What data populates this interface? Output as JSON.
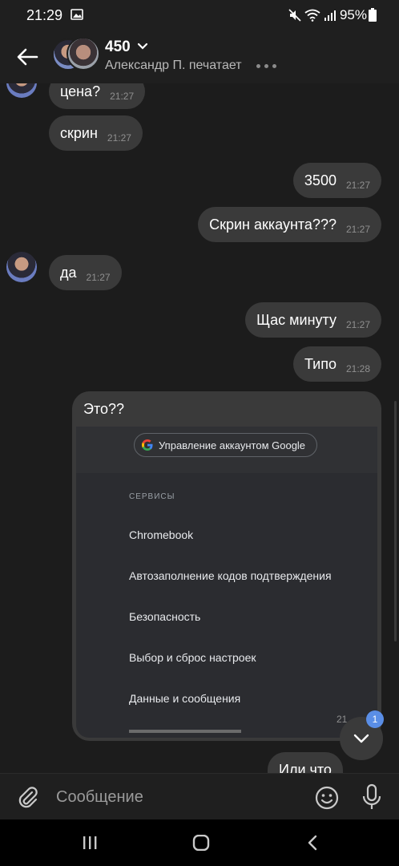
{
  "status_bar": {
    "time": "21:29",
    "battery": "95%"
  },
  "header": {
    "title": "450",
    "subtitle": "Александр П. печатает"
  },
  "messages": [
    {
      "side": "in",
      "text": "цена?",
      "time": "21:27"
    },
    {
      "side": "in",
      "text": "скрин",
      "time": "21:27"
    },
    {
      "side": "out",
      "text": "3500",
      "time": "21:27"
    },
    {
      "side": "out",
      "text": "Скрин аккаунта???",
      "time": "21:27"
    },
    {
      "side": "in",
      "text": "да",
      "time": "21:27"
    },
    {
      "side": "out",
      "text": "Щас минуту",
      "time": "21:27"
    },
    {
      "side": "out",
      "text": "Типо",
      "time": "21:28"
    },
    {
      "side": "out",
      "text": "Это??",
      "time": ""
    },
    {
      "side": "out",
      "text": "Или что",
      "time": ""
    }
  ],
  "shared_screenshot": {
    "account_button": "Управление аккаунтом Google",
    "section": "СЕРВИСЫ",
    "items": [
      "Chromebook",
      "Автозаполнение кодов подтверждения",
      "Безопасность",
      "Выбор и сброс настроек",
      "Данные и сообщения"
    ]
  },
  "jump": {
    "unread": "1",
    "peek_time": "21"
  },
  "composer": {
    "placeholder": "Сообщение"
  },
  "icons": [
    "back-arrow-icon",
    "chevron-down-icon",
    "attach-icon",
    "emoji-icon",
    "mic-icon",
    "google-g-icon",
    "chevron-down-icon"
  ]
}
